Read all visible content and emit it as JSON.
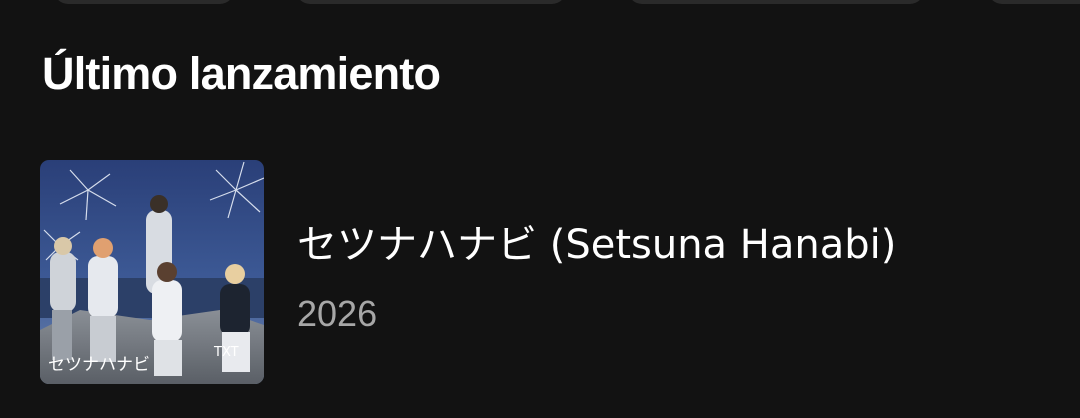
{
  "section": {
    "title": "Último lanzamiento"
  },
  "latest_release": {
    "title": "セツナハナビ (Setsuna Hanabi)",
    "year": "2026",
    "cover": {
      "icon": "album-cover-image",
      "text_left": "セツナハナビ",
      "text_right": "TXT"
    }
  },
  "colors": {
    "background": "#121212",
    "primary_text": "#ffffff",
    "secondary_text": "#a7a7a7",
    "chip": "#2a2a2a"
  }
}
